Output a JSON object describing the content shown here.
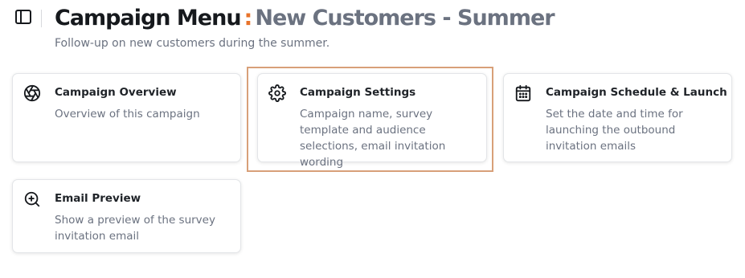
{
  "header": {
    "title": "Campaign Menu",
    "separator": ":",
    "campaign_name": "New Customers - Summer",
    "subtitle": "Follow-up on new customers during the summer."
  },
  "cards": [
    {
      "title": "Campaign Overview",
      "description": "Overview of this campaign",
      "icon": "aperture-icon",
      "selected": false
    },
    {
      "title": "Campaign Settings",
      "description": "Campaign name, survey template and audience selections, email invitation wording",
      "icon": "gear-icon",
      "selected": true
    },
    {
      "title": "Campaign Schedule & Launch",
      "description": "Set the date and time for launching the outbound invitation emails",
      "icon": "calendar-icon",
      "selected": false
    },
    {
      "title": "Email Preview",
      "description": "Show a preview of the survey invitation email",
      "icon": "zoom-in-icon",
      "selected": false
    }
  ],
  "colors": {
    "accent": "#e8732a",
    "selection_outline": "#d8a079",
    "muted_text": "#6b7280"
  }
}
